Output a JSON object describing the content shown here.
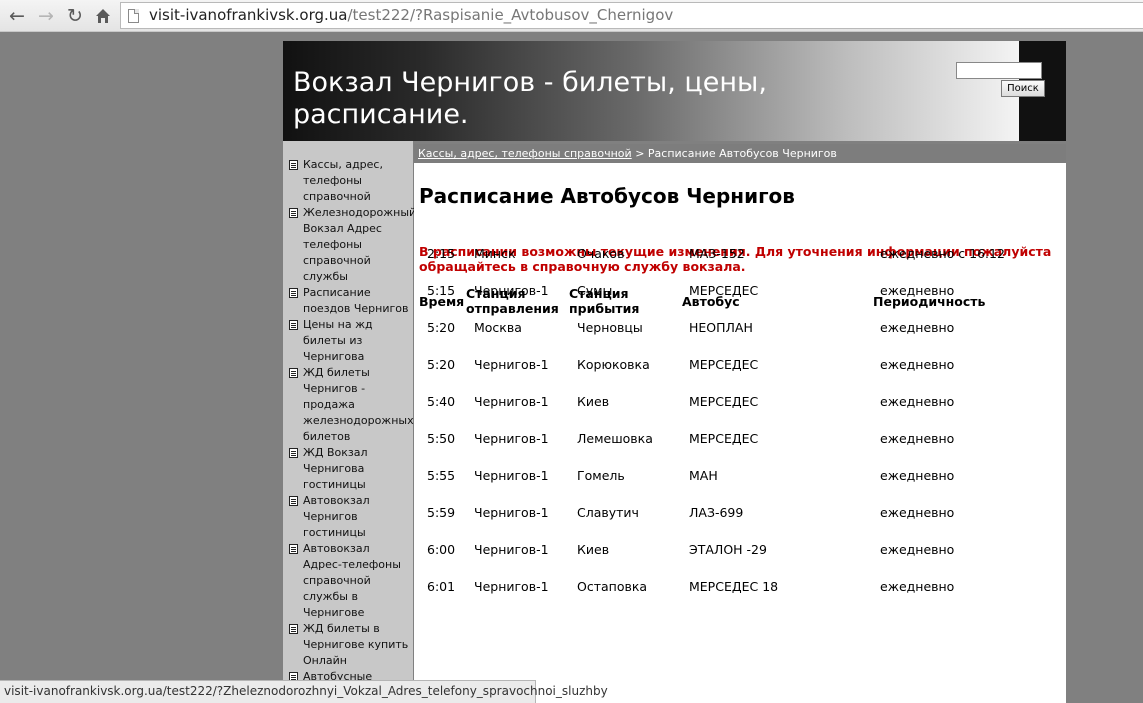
{
  "browser": {
    "url_host": "visit-ivanofrankivsk.org.ua",
    "url_path": "/test222/?Raspisanie_Avtobusov_Chernigov",
    "status_url": "visit-ivanofrankivsk.org.ua/test222/?Zheleznodorozhnyi_Vokzal_Adres_telefony_spravochnoi_sluzhby"
  },
  "header": {
    "title": "Вокзал Чернигов - билеты, цены, расписание.",
    "search_button": "Поиск"
  },
  "sidebar": {
    "items": [
      {
        "label": "Кассы, адрес, телефоны справочной"
      },
      {
        "label": "Железнодорожный Вокзал Адрес телефоны справочной службы"
      },
      {
        "label": "Расписание поездов Чернигов"
      },
      {
        "label": "Цены на жд билеты из Чернигова"
      },
      {
        "label": "ЖД билеты Чернигов - продажа железнодорожных билетов"
      },
      {
        "label": "ЖД Вокзал Чернигова гостиницы"
      },
      {
        "label": "Автовокзал Чернигов гостиницы"
      },
      {
        "label": "Автовокзал Адрес-телефоны справочной службы в Чернигове"
      },
      {
        "label": "ЖД билеты в Чернигове купить Онлайн"
      },
      {
        "label": "Автобусные"
      }
    ]
  },
  "breadcrumb": {
    "link": "Кассы, адрес, телефоны справочной",
    "separator": ">",
    "current": "Расписание Автобусов Чернигов"
  },
  "main": {
    "heading": "Расписание Автобусов Чернигов",
    "notice": "В расписании возможны текущие изменения. Для уточнения информации пожалуйста обращайтесь в справочную службу вокзала."
  },
  "table": {
    "headers": {
      "time": "Время",
      "from": "Станция отправления",
      "to": "Станция прибытия",
      "bus": "Автобус",
      "period": "Периодичность"
    },
    "rows": [
      {
        "time": "2:15",
        "from": "Минск",
        "to": "Очаков",
        "bus": "МАЗ-152",
        "period": "ежедневно с 16.12"
      },
      {
        "time": "5:15",
        "from": "Чернигов-1",
        "to": "Сумы",
        "bus": "МЕРСЕДЕС",
        "period": "ежедневно"
      },
      {
        "time": "5:20",
        "from": "Москва",
        "to": "Черновцы",
        "bus": "НЕОПЛАН",
        "period": "ежедневно"
      },
      {
        "time": "5:20",
        "from": "Чернигов-1",
        "to": "Корюковка",
        "bus": "МЕРСЕДЕС",
        "period": "ежедневно"
      },
      {
        "time": "5:40",
        "from": "Чернигов-1",
        "to": "Киев",
        "bus": "МЕРСЕДЕС",
        "period": "ежедневно"
      },
      {
        "time": "5:50",
        "from": "Чернигов-1",
        "to": "Лемешовка",
        "bus": "МЕРСЕДЕС",
        "period": "ежедневно"
      },
      {
        "time": "5:55",
        "from": "Чернигов-1",
        "to": "Гомель",
        "bus": "МАН",
        "period": "ежедневно"
      },
      {
        "time": "5:59",
        "from": "Чернигов-1",
        "to": "Славутич",
        "bus": "ЛАЗ-699",
        "period": "ежедневно"
      },
      {
        "time": "6:00",
        "from": "Чернигов-1",
        "to": "Киев",
        "bus": "ЭТАЛОН -29",
        "period": "ежедневно"
      },
      {
        "time": "6:01",
        "from": "Чернигов-1",
        "to": "Остаповка",
        "bus": "МЕРСЕДЕС 18",
        "period": "ежедневно"
      }
    ]
  }
}
